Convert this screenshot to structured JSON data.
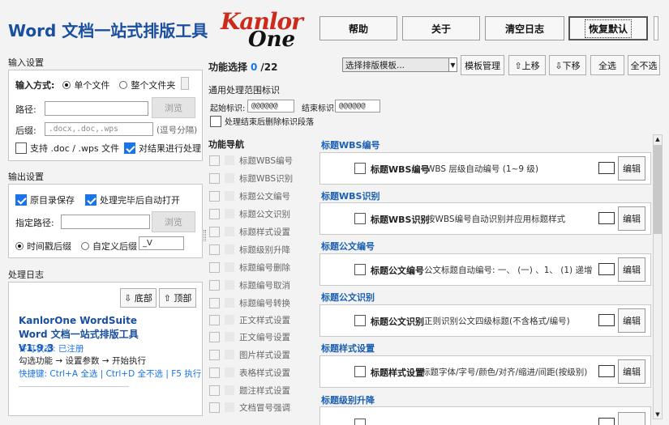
{
  "app": {
    "title": "Word 文档一站式排版工具",
    "logo_top": "Kanlor",
    "logo_bottom": "One"
  },
  "header": {
    "help": "帮助",
    "about": "关于",
    "clear_log": "清空日志",
    "restore": "恢复默认"
  },
  "input": {
    "title": "输入设置",
    "mode_label": "输入方式:",
    "single_file": "单个文件",
    "whole_folder": "整个文件夹",
    "path_label": "路径:",
    "path_value": "",
    "browse": "浏览",
    "suffix_label": "后缀:",
    "suffix_placeholder": ".docx,.doc,.wps",
    "suffix_hint": "(逗号分隔)",
    "support_doc": "支持 .doc / .wps 文件",
    "process_result": "对结果进行处理"
  },
  "output": {
    "title": "输出设置",
    "keep_dir": "原目录保存",
    "auto_open": "处理完毕后自动打开",
    "path_label": "指定路径:",
    "browse": "浏览",
    "timestamp": "时间戳后缀",
    "custom_suffix": "自定义后缀",
    "custom_value": "_V"
  },
  "log": {
    "title": "处理日志",
    "bottom": "⇩ 底部",
    "top": "⇧ 顶部",
    "product": "KanlorOne WordSuite Word 文档一站式排版工具 V1.9.3",
    "license": "许可状态: 已注册",
    "flow": "勾选功能 → 设置参数 → 开始执行",
    "shortcuts": "快捷键: Ctrl+A 全选 | Ctrl+D 全不选 | F5 执行"
  },
  "functions": {
    "label": "功能选择",
    "selected": "0",
    "total": "/22",
    "template_placeholder": "选择排版模板...",
    "template_mgr": "模板管理",
    "move_up": "⇧上移",
    "move_down": "⇩下移",
    "select_all": "全选",
    "select_none": "全不选",
    "range_title": "通用处理范围标识",
    "start_label": "起始标识:",
    "start_value": "@@@@@@",
    "end_label": "结束标识:",
    "end_value": "@@@@@@",
    "delete_marks": "处理结束后删除标识段落",
    "nav_title": "功能导航"
  },
  "nav": [
    "标题WBS编号",
    "标题WBS识别",
    "标题公文编号",
    "标题公文识别",
    "标题样式设置",
    "标题级别升降",
    "标题编号删除",
    "标题编号取消",
    "标题编号转换",
    "正文样式设置",
    "正文编号设置",
    "图片样式设置",
    "表格样式设置",
    "题注样式设置",
    "文档冒号强调"
  ],
  "sections": [
    {
      "title": "标题WBS编号",
      "name": "标题WBS编号",
      "desc": "WBS 层级自动编号 (1~9 级)"
    },
    {
      "title": "标题WBS识别",
      "name": "标题WBS识别",
      "desc": "按WBS编号自动识别并应用标题样式"
    },
    {
      "title": "标题公文编号",
      "name": "标题公文编号",
      "desc": "公文标题自动编号: 一、 (一) 、1、 (1) 递增"
    },
    {
      "title": "标题公文识别",
      "name": "标题公文识别",
      "desc": "正则识别公文四级标题(不含格式/编号)"
    },
    {
      "title": "标题样式设置",
      "name": "标题样式设置",
      "desc": "标题字体/字号/颜色/对齐/缩进/间距(按级别)"
    },
    {
      "title": "标题级别升降",
      "name": "",
      "desc": ""
    }
  ],
  "edit_label": "编辑",
  "colors": {
    "title_blue": "#1a4fa0",
    "section_blue": "#1a5fb4",
    "link_blue": "#1a73e8",
    "check_blue": "#1a73e8"
  }
}
